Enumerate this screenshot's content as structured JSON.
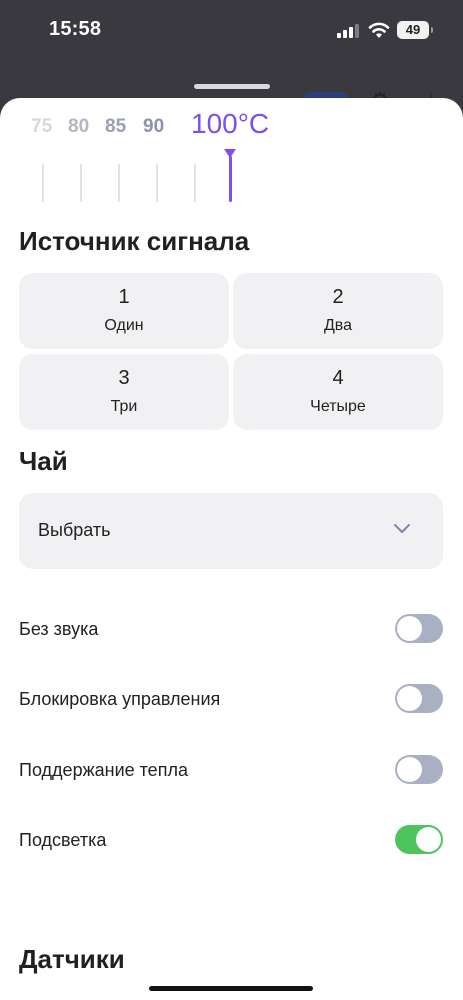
{
  "status_bar": {
    "time": "15:58",
    "battery": "49"
  },
  "temperature": {
    "values": [
      "75",
      "80",
      "85",
      "90"
    ],
    "selected": "100°C"
  },
  "signal_source": {
    "title": "Источник сигнала",
    "options": [
      {
        "number": "1",
        "label": "Один"
      },
      {
        "number": "2",
        "label": "Два"
      },
      {
        "number": "3",
        "label": "Три"
      },
      {
        "number": "4",
        "label": "Четыре"
      }
    ]
  },
  "tea": {
    "title": "Чай",
    "select_value": "Выбрать"
  },
  "settings": [
    {
      "label": "Без звука",
      "on": false
    },
    {
      "label": "Блокировка управления",
      "on": false
    },
    {
      "label": "Поддержание тепла",
      "on": false
    },
    {
      "label": "Подсветка",
      "on": true
    }
  ],
  "sensors": {
    "title": "Датчики"
  },
  "colors": {
    "accent": "#7b4ff0",
    "toggle_on": "#4fc45c",
    "toggle_off": "#aab0c4"
  }
}
